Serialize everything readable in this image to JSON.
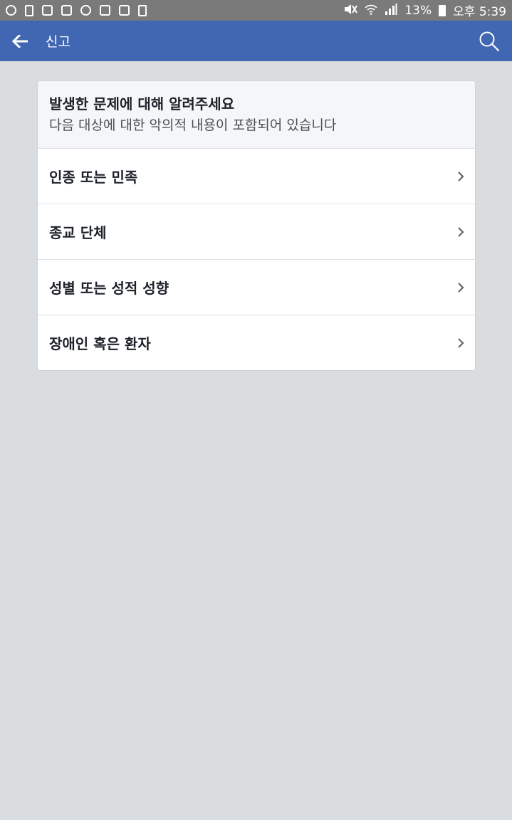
{
  "status_bar": {
    "battery_percent": "13%",
    "time": "오후 5:39",
    "icons_left": [
      "app-icon",
      "alert-icon",
      "gallery-icon",
      "instagram-icon",
      "talk-icon",
      "instagram-icon",
      "instagram-icon",
      "recycle-icon"
    ],
    "icons_right": [
      "mute-icon",
      "wifi-icon",
      "signal-icon",
      "battery-icon"
    ]
  },
  "app_bar": {
    "title": "신고",
    "color": "#4267b2"
  },
  "card": {
    "title": "발생한 문제에 대해 알려주세요",
    "subtitle": "다음 대상에 대한 악의적 내용이 포함되어 있습니다",
    "options": [
      {
        "label": "인종 또는 민족"
      },
      {
        "label": "종교 단체"
      },
      {
        "label": "성별 또는 성적 성향"
      },
      {
        "label": "장애인 혹은 환자"
      }
    ]
  }
}
